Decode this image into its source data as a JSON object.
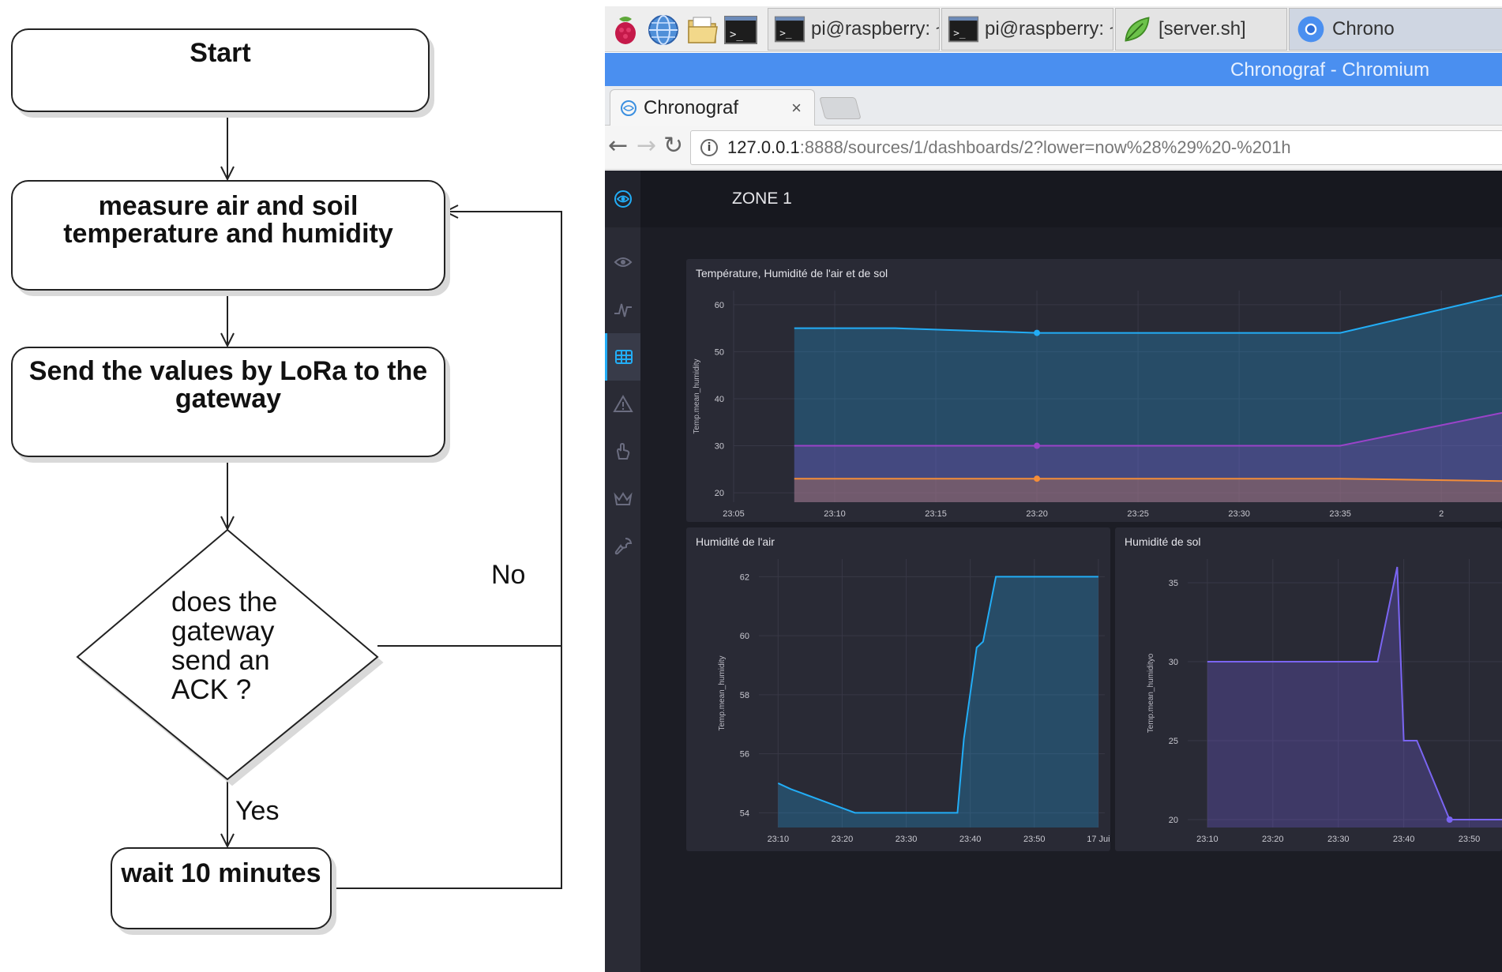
{
  "flowchart": {
    "start": "Start",
    "measure": [
      "measure air and soil",
      "temperature and humidity"
    ],
    "send": [
      "Send the values by LoRa to the",
      "gateway"
    ],
    "decision": [
      "does the",
      "gateway",
      "send an",
      "ACK ?"
    ],
    "no_label": "No",
    "yes_label": "Yes",
    "wait": "wait 10 minutes"
  },
  "taskbar": {
    "buttons": [
      {
        "label": "pi@raspberry: ~",
        "icon": "terminal-icon"
      },
      {
        "label": "pi@raspberry: ~",
        "icon": "terminal-icon"
      },
      {
        "label": "[server.sh]",
        "icon": "leafpad-icon"
      },
      {
        "label": "Chrono",
        "icon": "chromium-icon"
      }
    ],
    "launchers": [
      "raspberry-menu-icon",
      "web-browser-icon",
      "file-manager-icon",
      "terminal-icon"
    ]
  },
  "window_title": "Chronograf - Chromium",
  "tab": {
    "title": "Chronograf",
    "close": "×"
  },
  "address": {
    "host": "127.0.0.1",
    "rest": ":8888/sources/1/dashboards/2?lower=now%28%29%20-%201h",
    "info": "i"
  },
  "dashboard": {
    "name": "ZONE 1",
    "sidebar_icons": [
      "chronograf-logo-icon",
      "eye-icon",
      "pulse-icon",
      "dashboard-icon",
      "alert-icon",
      "hand-icon",
      "crown-icon",
      "wrench-icon"
    ]
  },
  "colors": {
    "cyan": "#22adf6",
    "purple": "#9a43c9",
    "orange": "#f48d38",
    "violet": "#7a65f2",
    "panel_bg": "#292a35",
    "grid": "#383846"
  },
  "chart_data": [
    {
      "type": "area",
      "title": "Température, Humidité de l'air et de sol",
      "ylabel": "Temp.mean_humidity",
      "ylim": [
        18,
        63
      ],
      "yticks": [
        20,
        30,
        40,
        50,
        60
      ],
      "xlim": [
        0,
        38
      ],
      "xtick_positions": [
        0,
        5,
        10,
        15,
        20,
        25,
        30,
        35
      ],
      "xtick_labels": [
        "23:05",
        "23:10",
        "23:15",
        "23:20",
        "23:25",
        "23:30",
        "23:35",
        "2"
      ],
      "series": [
        {
          "color": "#22adf6",
          "x": [
            3,
            8,
            15,
            30,
            38
          ],
          "y": [
            55,
            55,
            54,
            54,
            62
          ],
          "marker_x": 15
        },
        {
          "color": "#9a43c9",
          "x": [
            3,
            15,
            30,
            38
          ],
          "y": [
            30,
            30,
            30,
            37
          ],
          "marker_x": 15
        },
        {
          "color": "#f48d38",
          "x": [
            3,
            15,
            30,
            38
          ],
          "y": [
            23,
            23,
            23,
            22.5
          ],
          "marker_x": 15
        }
      ]
    },
    {
      "type": "area",
      "title": "Humidité de l'air",
      "ylabel": "Temp.mean_humidity",
      "ylim": [
        53.5,
        62.6
      ],
      "yticks": [
        54,
        56,
        58,
        60,
        62
      ],
      "xlim": [
        0,
        54
      ],
      "xtick_positions": [
        3,
        13,
        23,
        33,
        43,
        53
      ],
      "xtick_labels": [
        "23:10",
        "23:20",
        "23:30",
        "23:40",
        "23:50",
        "17 Jui"
      ],
      "series": [
        {
          "color": "#22adf6",
          "x": [
            3,
            5,
            15,
            19,
            29,
            31,
            32,
            34,
            35,
            37,
            53
          ],
          "y": [
            55,
            54.8,
            54,
            54,
            54,
            54,
            56.5,
            59.6,
            59.8,
            62,
            62
          ]
        }
      ]
    },
    {
      "type": "area",
      "title": "Humidité de sol",
      "ylabel": "Temp.mean_humidityo",
      "ylim": [
        19.5,
        36.5
      ],
      "yticks": [
        20,
        25,
        30,
        35
      ],
      "xlim": [
        0,
        48
      ],
      "xtick_positions": [
        3,
        13,
        23,
        33,
        43
      ],
      "xtick_labels": [
        "23:10",
        "23:20",
        "23:30",
        "23:40",
        "23:50"
      ],
      "series": [
        {
          "color": "#7a65f2",
          "x": [
            3,
            10,
            20,
            29,
            32,
            33,
            35,
            37,
            40,
            48
          ],
          "y": [
            30,
            30,
            30,
            30,
            36,
            25,
            25,
            23,
            20,
            20
          ],
          "marker_x": 40
        }
      ]
    }
  ]
}
